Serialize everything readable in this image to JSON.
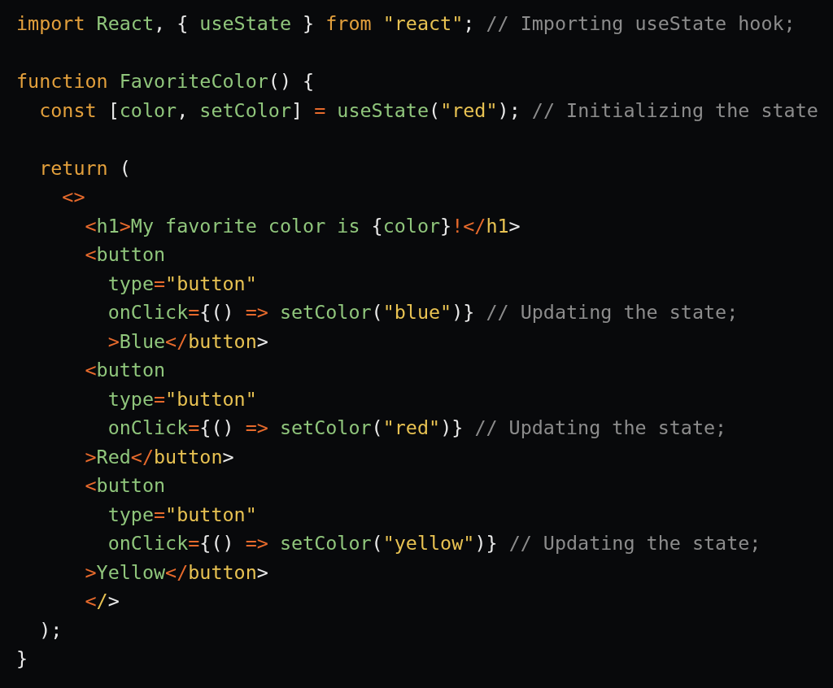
{
  "code_lines": [
    {
      "tokens": [
        {
          "kind": "k",
          "text": "import"
        },
        {
          "kind": "n",
          "text": " React"
        },
        {
          "kind": "p",
          "text": ", { "
        },
        {
          "kind": "n",
          "text": "useState"
        },
        {
          "kind": "p",
          "text": " } "
        },
        {
          "kind": "k",
          "text": "from"
        },
        {
          "kind": "s",
          "text": " \"react\""
        },
        {
          "kind": "p",
          "text": "; "
        },
        {
          "kind": "c",
          "text": "// Importing useState hook;"
        }
      ]
    },
    {
      "space_before": true,
      "tokens": [
        {
          "kind": "k",
          "text": "function"
        },
        {
          "kind": "n",
          "text": " FavoriteColor"
        },
        {
          "kind": "p",
          "text": "() {"
        }
      ]
    },
    {
      "tokens": [
        {
          "kind": "k",
          "text": "  const"
        },
        {
          "kind": "p",
          "text": " ["
        },
        {
          "kind": "n",
          "text": "color"
        },
        {
          "kind": "p",
          "text": ", "
        },
        {
          "kind": "n",
          "text": "setColor"
        },
        {
          "kind": "p",
          "text": "] "
        },
        {
          "kind": "o",
          "text": "="
        },
        {
          "kind": "n",
          "text": " useState"
        },
        {
          "kind": "p",
          "text": "("
        },
        {
          "kind": "s",
          "text": "\"red\""
        },
        {
          "kind": "p",
          "text": "); "
        },
        {
          "kind": "c",
          "text": "// Initializing the state"
        }
      ]
    },
    {
      "space_before": true,
      "tokens": [
        {
          "kind": "k",
          "text": "  return"
        },
        {
          "kind": "p",
          "text": " ("
        }
      ]
    },
    {
      "tokens": [
        {
          "kind": "o",
          "text": "    <>"
        }
      ]
    },
    {
      "tokens": [
        {
          "kind": "o",
          "text": "      <"
        },
        {
          "kind": "n",
          "text": "h1"
        },
        {
          "kind": "o",
          "text": ">"
        },
        {
          "kind": "n",
          "text": "My favorite color is "
        },
        {
          "kind": "p",
          "text": "{"
        },
        {
          "kind": "n",
          "text": "color"
        },
        {
          "kind": "p",
          "text": "}"
        },
        {
          "kind": "o",
          "text": "!</"
        },
        {
          "kind": "s",
          "text": "h1"
        },
        {
          "kind": "p",
          "text": ">"
        }
      ]
    },
    {
      "tokens": [
        {
          "kind": "o",
          "text": "      <"
        },
        {
          "kind": "n",
          "text": "button"
        }
      ]
    },
    {
      "tokens": [
        {
          "kind": "n",
          "text": "        type"
        },
        {
          "kind": "o",
          "text": "="
        },
        {
          "kind": "s",
          "text": "\"button\""
        }
      ]
    },
    {
      "tokens": [
        {
          "kind": "n",
          "text": "        onClick"
        },
        {
          "kind": "o",
          "text": "="
        },
        {
          "kind": "p",
          "text": "{() "
        },
        {
          "kind": "o",
          "text": "=>"
        },
        {
          "kind": "n",
          "text": " setColor"
        },
        {
          "kind": "p",
          "text": "("
        },
        {
          "kind": "s",
          "text": "\"blue\""
        },
        {
          "kind": "p",
          "text": ")} "
        },
        {
          "kind": "c",
          "text": "// Updating the state;"
        }
      ]
    },
    {
      "tokens": [
        {
          "kind": "o",
          "text": "        >"
        },
        {
          "kind": "n",
          "text": "Blue"
        },
        {
          "kind": "o",
          "text": "</"
        },
        {
          "kind": "s",
          "text": "button"
        },
        {
          "kind": "p",
          "text": ">"
        }
      ]
    },
    {
      "tokens": [
        {
          "kind": "o",
          "text": "      <"
        },
        {
          "kind": "n",
          "text": "button"
        }
      ]
    },
    {
      "tokens": [
        {
          "kind": "n",
          "text": "        type"
        },
        {
          "kind": "o",
          "text": "="
        },
        {
          "kind": "s",
          "text": "\"button\""
        }
      ]
    },
    {
      "tokens": [
        {
          "kind": "n",
          "text": "        onClick"
        },
        {
          "kind": "o",
          "text": "="
        },
        {
          "kind": "p",
          "text": "{() "
        },
        {
          "kind": "o",
          "text": "=>"
        },
        {
          "kind": "n",
          "text": " setColor"
        },
        {
          "kind": "p",
          "text": "("
        },
        {
          "kind": "s",
          "text": "\"red\""
        },
        {
          "kind": "p",
          "text": ")} "
        },
        {
          "kind": "c",
          "text": "// Updating the state;"
        }
      ]
    },
    {
      "tokens": [
        {
          "kind": "o",
          "text": "      >"
        },
        {
          "kind": "n",
          "text": "Red"
        },
        {
          "kind": "o",
          "text": "</"
        },
        {
          "kind": "s",
          "text": "button"
        },
        {
          "kind": "p",
          "text": ">"
        }
      ]
    },
    {
      "tokens": [
        {
          "kind": "o",
          "text": "      <"
        },
        {
          "kind": "n",
          "text": "button"
        }
      ]
    },
    {
      "tokens": [
        {
          "kind": "n",
          "text": "        type"
        },
        {
          "kind": "o",
          "text": "="
        },
        {
          "kind": "s",
          "text": "\"button\""
        }
      ]
    },
    {
      "tokens": [
        {
          "kind": "n",
          "text": "        onClick"
        },
        {
          "kind": "o",
          "text": "="
        },
        {
          "kind": "p",
          "text": "{() "
        },
        {
          "kind": "o",
          "text": "=>"
        },
        {
          "kind": "n",
          "text": " setColor"
        },
        {
          "kind": "p",
          "text": "("
        },
        {
          "kind": "s",
          "text": "\"yellow\""
        },
        {
          "kind": "p",
          "text": ")} "
        },
        {
          "kind": "c",
          "text": "// Updating the state;"
        }
      ]
    },
    {
      "tokens": [
        {
          "kind": "o",
          "text": "      >"
        },
        {
          "kind": "n",
          "text": "Yellow"
        },
        {
          "kind": "o",
          "text": "</"
        },
        {
          "kind": "s",
          "text": "button"
        },
        {
          "kind": "p",
          "text": ">"
        }
      ]
    },
    {
      "tokens": [
        {
          "kind": "o",
          "text": "      <"
        },
        {
          "kind": "s",
          "text": "/"
        },
        {
          "kind": "p",
          "text": ">"
        }
      ]
    },
    {
      "tokens": [
        {
          "kind": "p",
          "text": "  );"
        }
      ]
    },
    {
      "tokens": [
        {
          "kind": "p",
          "text": "}"
        }
      ]
    }
  ]
}
